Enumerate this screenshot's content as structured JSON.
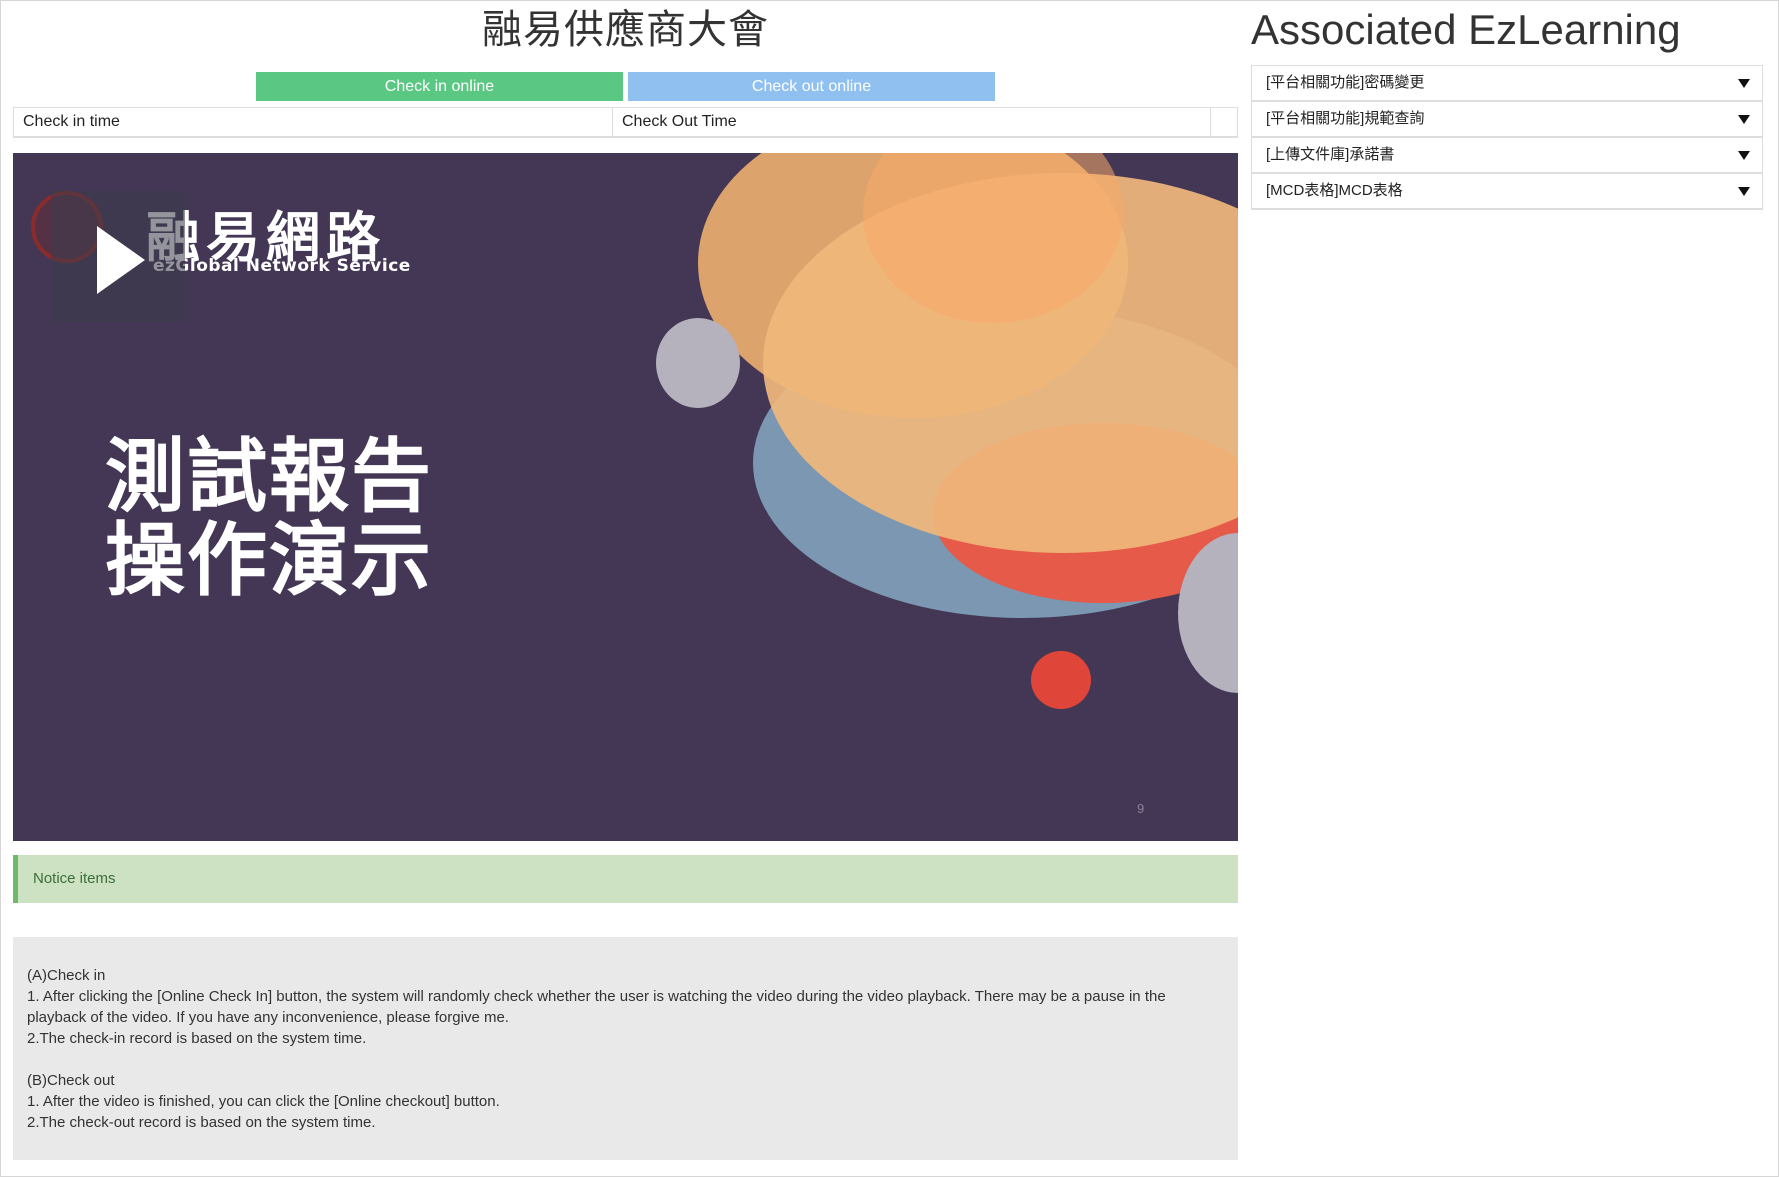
{
  "header": {
    "title": "融易供應商大會",
    "side_title": "Associated EzLearning"
  },
  "actions": {
    "check_in_label": "Check in online",
    "check_out_label": "Check out online"
  },
  "time_table": {
    "check_in_header": "Check in time",
    "check_out_header": "Check Out Time"
  },
  "video": {
    "logo_text_cn": "融易網路",
    "logo_text_en": "ezGlobal Network Service",
    "slide_title_line1": "測試報告",
    "slide_title_line2": "操作演示",
    "slide_number": "9",
    "play_icon": "play-icon",
    "colors": {
      "background": "#433755",
      "orange": "#f0b77c",
      "blue": "#7c97b2",
      "red": "#e55a48",
      "gray": "#b5b1bd"
    }
  },
  "notice": {
    "title": "Notice items",
    "lines": [
      "(A)Check in",
      "1. After clicking the [Online Check In] button, the system will randomly check whether the user is watching the video during the video playback. There may be a pause in the playback of the video. If you have any inconvenience, please forgive me.",
      "2.The check-in record is based on the system time.",
      "(B)Check out",
      "1. After the video is finished, you can click the [Online checkout] button.",
      "2.The check-out record is based on the system time."
    ]
  },
  "sidebar": {
    "items": [
      {
        "label": "[平台相關功能]密碼變更",
        "icon": "caret-down-icon"
      },
      {
        "label": "[平台相關功能]規範查詢",
        "icon": "caret-down-icon"
      },
      {
        "label": "[上傳文件庫]承諾書",
        "icon": "caret-down-icon"
      },
      {
        "label": "[MCD表格]MCD表格",
        "icon": "caret-down-icon"
      }
    ]
  },
  "colors": {
    "check_in_button": "#5ac882",
    "check_out_button": "#8fc0f0",
    "notice_bar": "#cde2c3",
    "notice_body": "#e9e9e9"
  }
}
